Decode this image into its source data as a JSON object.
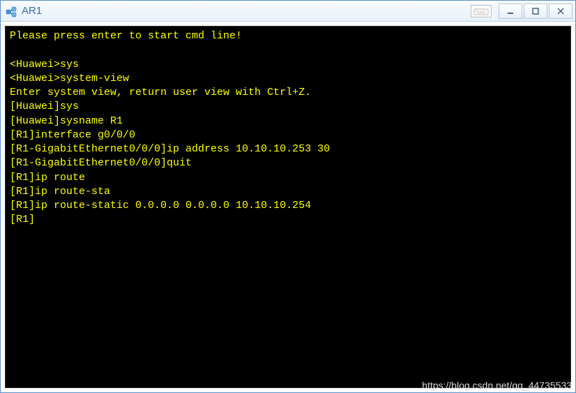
{
  "window": {
    "title": "AR1"
  },
  "terminal": {
    "lines": [
      "Please press enter to start cmd line!",
      "",
      "<Huawei>sys",
      "<Huawei>system-view",
      "Enter system view, return user view with Ctrl+Z.",
      "[Huawei]sys",
      "[Huawei]sysname R1",
      "[R1]interface g0/0/0",
      "[R1-GigabitEthernet0/0/0]ip address 10.10.10.253 30",
      "[R1-GigabitEthernet0/0/0]quit",
      "[R1]ip route",
      "[R1]ip route-sta",
      "[R1]ip route-static 0.0.0.0 0.0.0.0 10.10.10.254",
      "[R1]"
    ]
  },
  "watermark": "https://blog.csdn.net/qq_44735533"
}
